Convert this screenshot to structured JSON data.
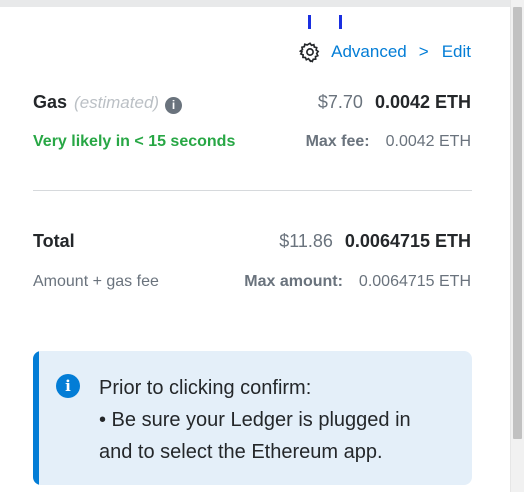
{
  "gas_options": {
    "advanced_label": "Advanced",
    "chevron": ">",
    "edit_label": "Edit"
  },
  "gas": {
    "label": "Gas",
    "estimated_label": "(estimated)",
    "info_icon": "i",
    "fiat": "$7.70",
    "crypto": "0.0042 ETH",
    "likelihood": "Very likely in < 15 seconds",
    "max_fee_label": "Max fee:",
    "max_fee_value": "0.0042 ETH"
  },
  "total": {
    "label": "Total",
    "fiat": "$11.86",
    "crypto": "0.0064715 ETH",
    "sub_label": "Amount + gas fee",
    "max_amount_label": "Max amount:",
    "max_amount_value": "0.0064715 ETH"
  },
  "notice": {
    "icon": "i",
    "title": "Prior to clicking confirm:",
    "line1": "• Be sure your Ledger is plugged in",
    "line2": "and to select the Ethereum app."
  },
  "colors": {
    "accent": "#037dd6",
    "success": "#28a745",
    "notice_bg": "#e4eff9"
  }
}
